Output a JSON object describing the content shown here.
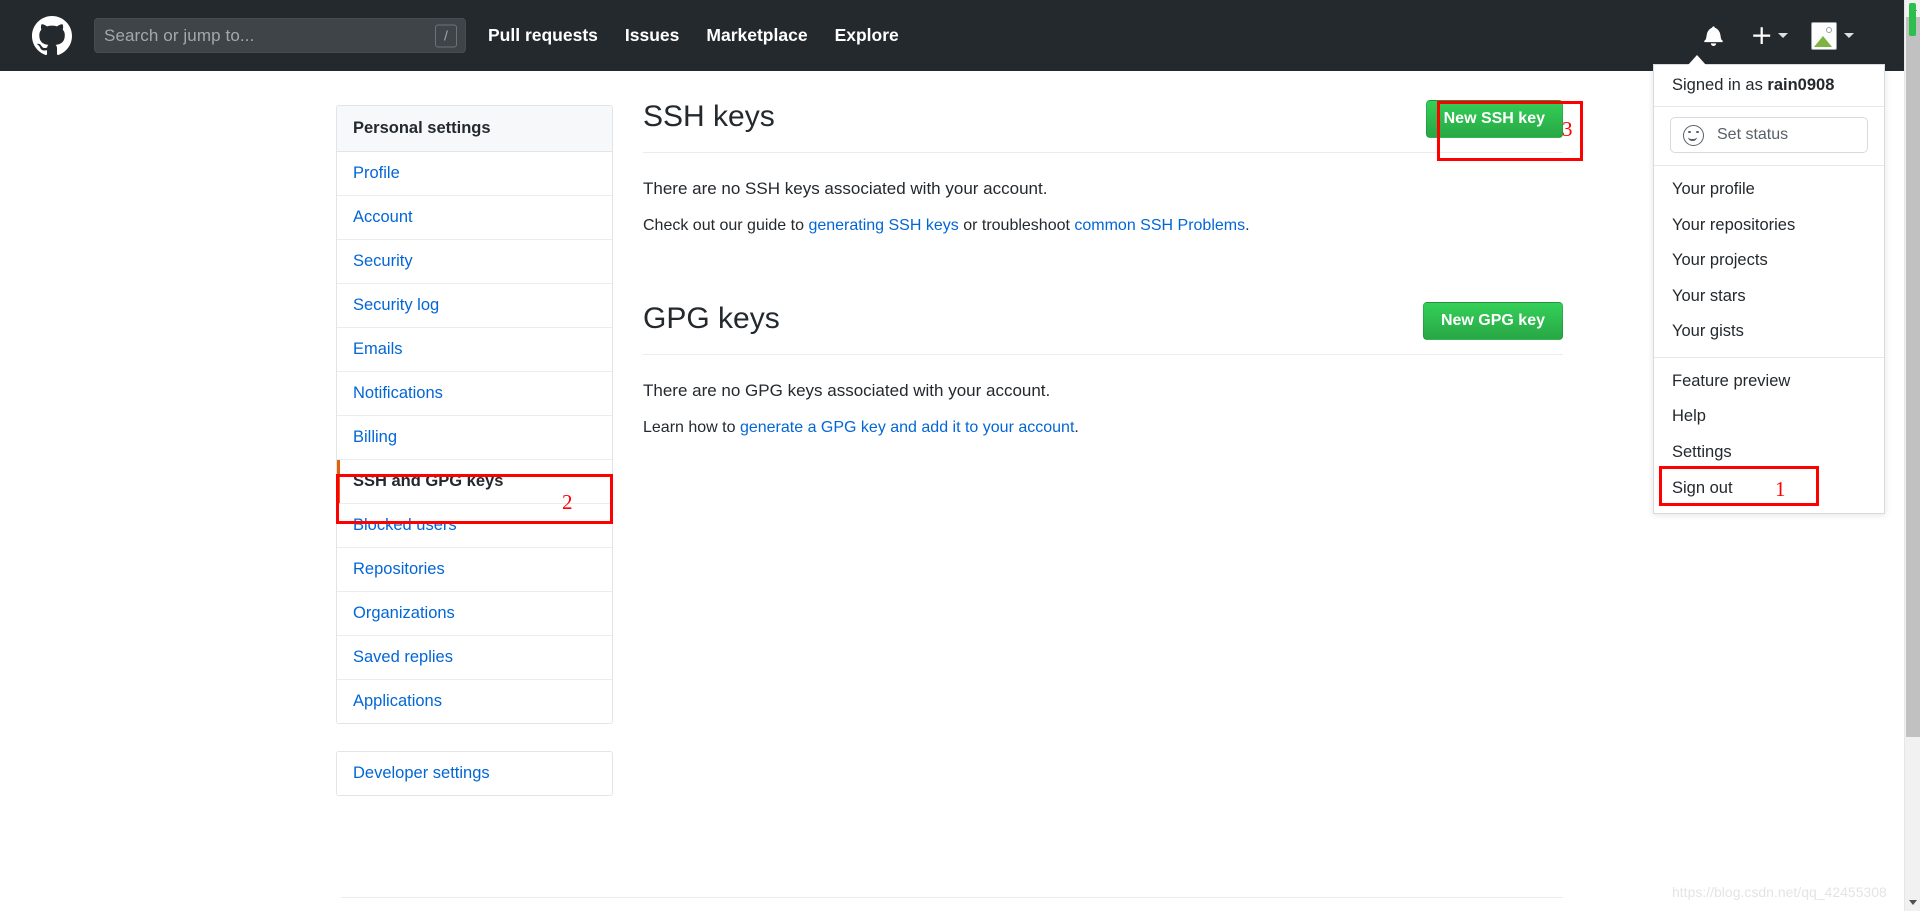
{
  "header": {
    "logo_icon": "github-mark-icon",
    "search": {
      "placeholder": "Search or jump to...",
      "shortcut": "/"
    },
    "nav": [
      {
        "label": "Pull requests"
      },
      {
        "label": "Issues"
      },
      {
        "label": "Marketplace"
      },
      {
        "label": "Explore"
      }
    ],
    "icons": {
      "notifications": "bell-icon",
      "create_new": "plus-icon",
      "create_new_caret": "chevron-down-icon",
      "avatar": "avatar-broken-image-icon",
      "avatar_caret": "chevron-down-icon"
    }
  },
  "user_menu": {
    "signed_in_prefix": "Signed in as",
    "username": "rain0908",
    "status": {
      "icon": "smiley-icon",
      "label": "Set status"
    },
    "group1": [
      {
        "label": "Your profile"
      },
      {
        "label": "Your repositories"
      },
      {
        "label": "Your projects"
      },
      {
        "label": "Your stars"
      },
      {
        "label": "Your gists"
      }
    ],
    "group2": [
      {
        "label": "Feature preview"
      },
      {
        "label": "Help"
      },
      {
        "label": "Settings"
      },
      {
        "label": "Sign out"
      }
    ]
  },
  "sidebar": {
    "heading": "Personal settings",
    "items": [
      {
        "label": "Profile",
        "active": false
      },
      {
        "label": "Account",
        "active": false
      },
      {
        "label": "Security",
        "active": false
      },
      {
        "label": "Security log",
        "active": false
      },
      {
        "label": "Emails",
        "active": false
      },
      {
        "label": "Notifications",
        "active": false
      },
      {
        "label": "Billing",
        "active": false
      },
      {
        "label": "SSH and GPG keys",
        "active": true
      },
      {
        "label": "Blocked users",
        "active": false
      },
      {
        "label": "Repositories",
        "active": false
      },
      {
        "label": "Organizations",
        "active": false
      },
      {
        "label": "Saved replies",
        "active": false
      },
      {
        "label": "Applications",
        "active": false
      }
    ],
    "developer": {
      "label": "Developer settings"
    }
  },
  "main": {
    "ssh": {
      "title": "SSH keys",
      "button": "New SSH key",
      "empty": "There are no SSH keys associated with your account.",
      "help_prefix": "Check out our guide to ",
      "help_link1": "generating SSH keys",
      "help_middle": " or troubleshoot ",
      "help_link2": "common SSH Problems",
      "help_suffix": "."
    },
    "gpg": {
      "title": "GPG keys",
      "button": "New GPG key",
      "empty": "There are no GPG keys associated with your account.",
      "help_prefix": "Learn how to ",
      "help_link1": "generate a GPG key and add it to your account",
      "help_suffix": "."
    }
  },
  "annotations": [
    {
      "number": "1",
      "target": "Settings"
    },
    {
      "number": "2",
      "target": "SSH and GPG keys"
    },
    {
      "number": "3",
      "target": "New SSH key"
    }
  ],
  "annotation_color": "#ff0000",
  "accent_color": "#0366d6",
  "active_color": "#e36209",
  "green_color": "#28a745",
  "watermark": "https://blog.csdn.net/qq_42455308",
  "scrollbar": {
    "up_icon": "chevron-up-icon",
    "down_icon": "chevron-down-icon"
  }
}
